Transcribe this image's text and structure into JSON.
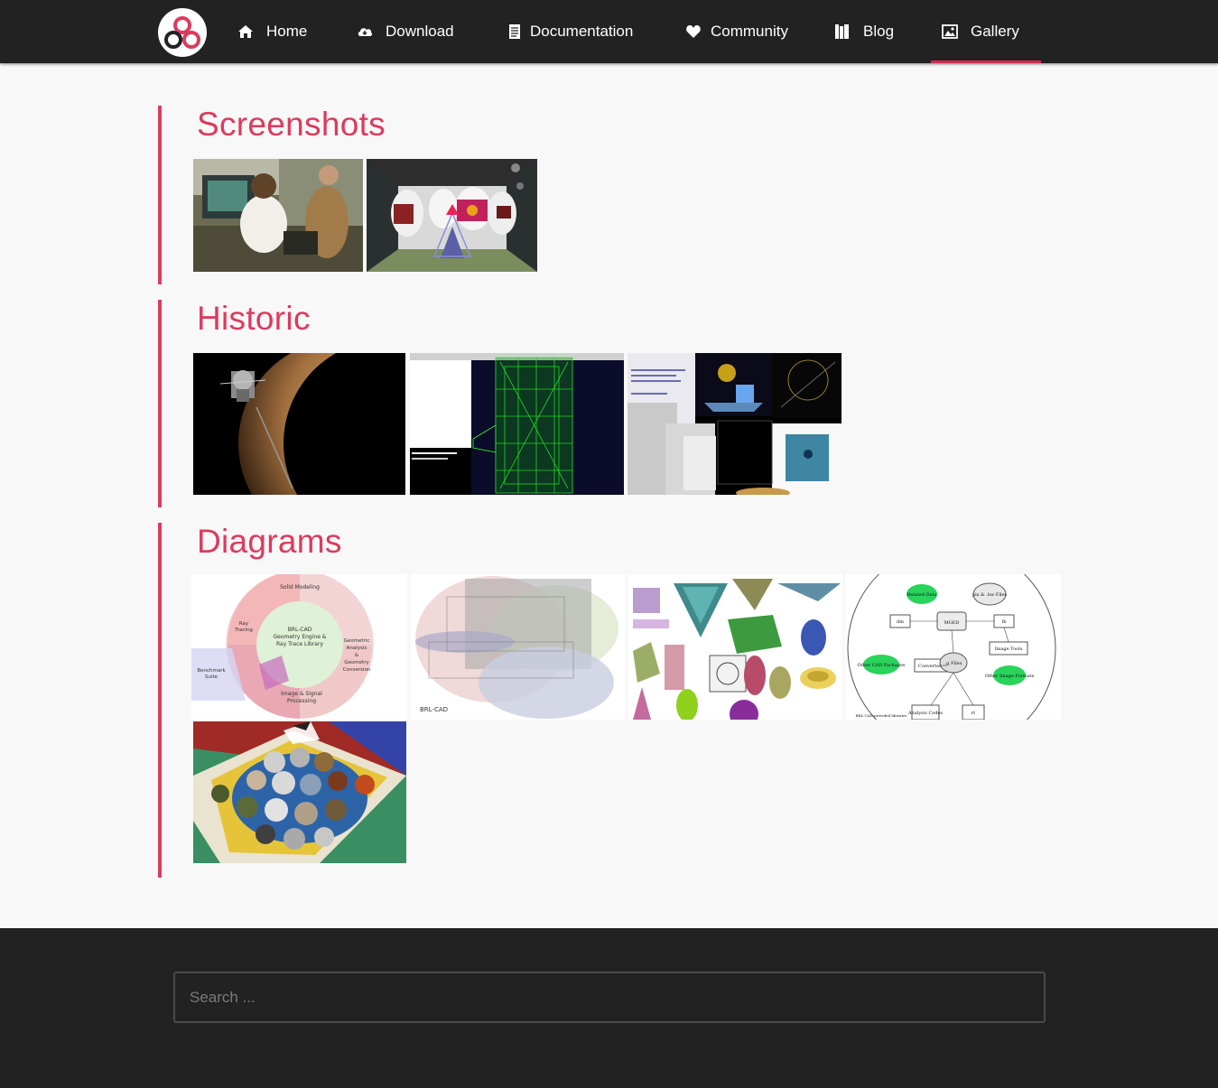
{
  "nav": {
    "items": [
      {
        "label": "Home",
        "icon": "home-icon"
      },
      {
        "label": "Download",
        "icon": "cloud-download-icon"
      },
      {
        "label": "Documentation",
        "icon": "document-icon"
      },
      {
        "label": "Community",
        "icon": "heart-icon"
      },
      {
        "label": "Blog",
        "icon": "book-icon"
      },
      {
        "label": "Gallery",
        "icon": "image-icon",
        "active": true
      }
    ]
  },
  "sections": {
    "screenshots": {
      "title": "Screenshots"
    },
    "historic": {
      "title": "Historic"
    },
    "diagrams": {
      "title": "Diagrams"
    }
  },
  "thumbs": {
    "ss1": "screenshot-computer-lab-photo",
    "ss2": "screenshot-raytraced-gallery-room",
    "h1": "historic-cassini-spacecraft-render",
    "h2": "historic-green-wireframe-model",
    "h3": "historic-mged-interface-collage",
    "d1": "diagram-brlcad-library-wheel",
    "d2": "diagram-brlcad-venn-layers",
    "d3": "diagram-primitive-shapes",
    "d4": "diagram-mged-flowchart",
    "d5": "diagram-sphereflake-medallion"
  },
  "diagram_text": {
    "d1_center": [
      "BRL-CAD",
      "Geometry Engine &",
      "Ray Trace Library"
    ],
    "d1_top": "Solid Modeling",
    "d1_left": [
      "Ray",
      "Tracing"
    ],
    "d1_right": [
      "Geometric",
      "Analysis",
      "&",
      "Geometry",
      "Conversion"
    ],
    "d1_bottom": [
      "Image & Signal",
      "Processing"
    ],
    "d1_bench": [
      "Benchmark",
      "Suite"
    ],
    "d2_label": "BRL-CAD",
    "d4_center": "MGED",
    "d4_nodes": [
      "Related Data",
      "pix & .bw Files",
      "dm",
      "fb",
      "Image Tools",
      "Other CAD Packages",
      "Converters",
      ".g Files",
      "Other Image Formats",
      "Analysis Codes",
      "rt"
    ],
    "d4_foot": "BRL-CAD-provided libraries"
  },
  "footer": {
    "search_placeholder": "Search ..."
  },
  "colors": {
    "accent": "#dc3b5d",
    "navbar": "#222222",
    "background": "#f8f8f8"
  }
}
